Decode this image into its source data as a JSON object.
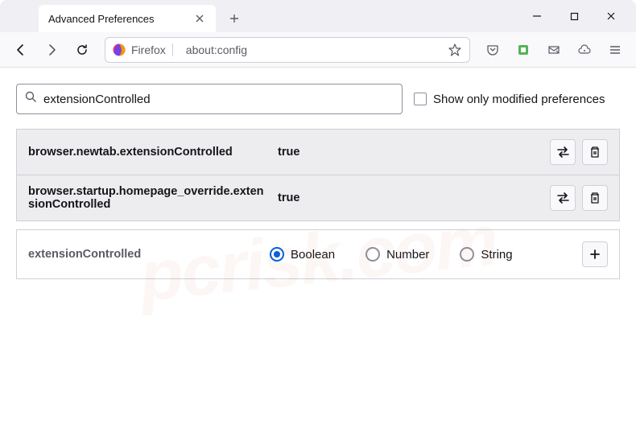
{
  "tab": {
    "title": "Advanced Preferences"
  },
  "urlbar": {
    "identity_label": "Firefox",
    "url": "about:config"
  },
  "search": {
    "value": "extensionControlled"
  },
  "checkbox": {
    "label": "Show only modified preferences"
  },
  "prefs": [
    {
      "name": "browser.newtab.extensionControlled",
      "value": "true"
    },
    {
      "name": "browser.startup.homepage_override.extensionControlled",
      "value": "true"
    }
  ],
  "new_pref": {
    "name": "extensionControlled",
    "types": [
      "Boolean",
      "Number",
      "String"
    ],
    "selected": 0
  },
  "watermark": "pcrisk.com"
}
